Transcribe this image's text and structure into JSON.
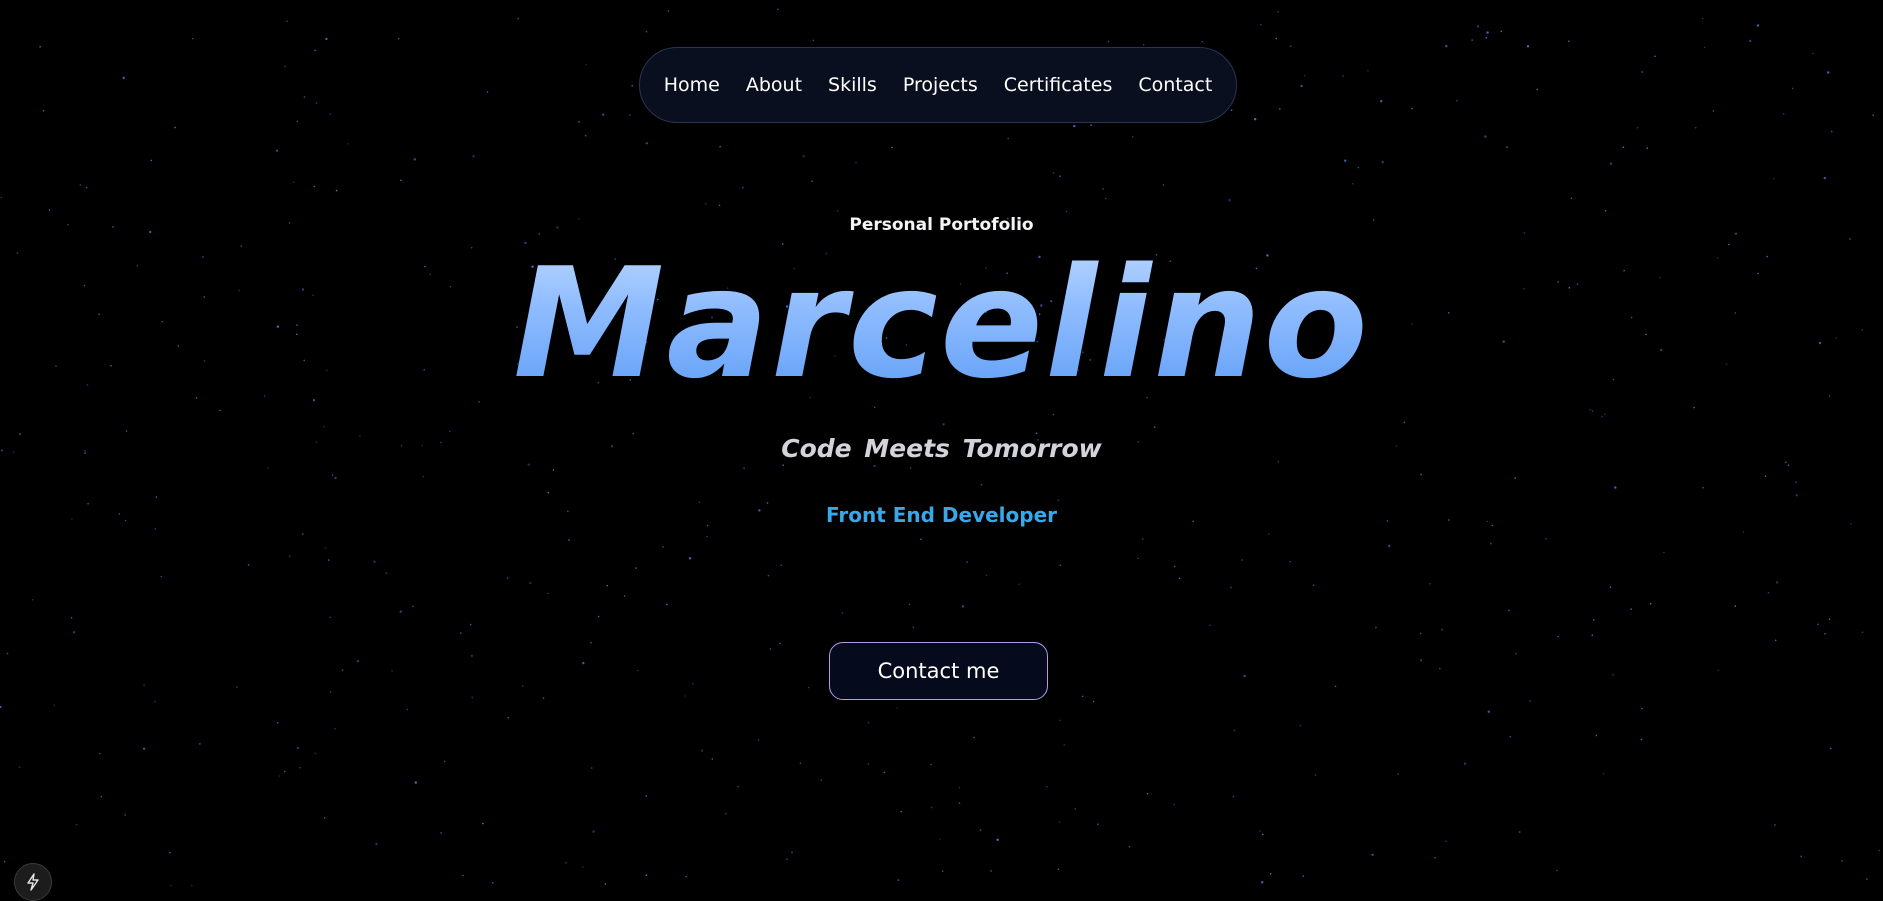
{
  "nav": {
    "items": [
      {
        "label": "Home"
      },
      {
        "label": "About"
      },
      {
        "label": "Skills"
      },
      {
        "label": "Projects"
      },
      {
        "label": "Certificates"
      },
      {
        "label": "Contact"
      }
    ]
  },
  "hero": {
    "eyebrow": "Personal Portofolio",
    "name": "Marcelino",
    "tagline": "Code Meets Tomorrow",
    "role": "Front End Developer",
    "cta_label": "Contact me"
  },
  "corner_button": {
    "icon": "lightning-icon"
  },
  "colors": {
    "background": "#000000",
    "star": "#4a7bd8",
    "name_gradient_top": "#bcd8ff",
    "name_gradient_bottom": "#5c9cf5",
    "role": "#38a8e8",
    "cta_border": "#b49bea"
  }
}
